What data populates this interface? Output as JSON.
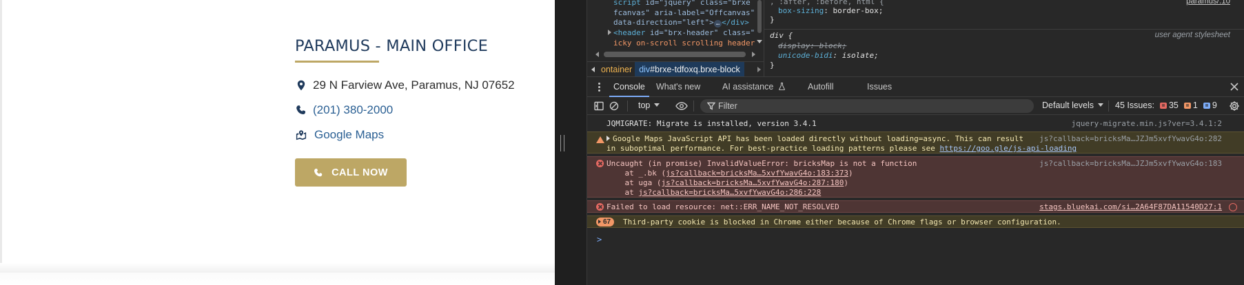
{
  "site": {
    "office_title": "PARAMUS - MAIN OFFICE",
    "address": "29 N Farview Ave, Paramus, NJ 07652",
    "phone": "(201) 380-2000",
    "maps_label": "Google Maps",
    "call_button": "CALL NOW",
    "colors": {
      "title": "#1f3a5c",
      "accent": "#bda765",
      "link": "#2a5f93"
    },
    "icons": {
      "address": "map-pin-icon",
      "phone": "phone-icon",
      "maps": "map-marked-icon",
      "call": "phone-icon"
    }
  },
  "devtools": {
    "elements": {
      "lines": [
        {
          "tag_open": "script",
          "attr": " id=\"jquery\" class=\"brxe",
          "text": ""
        },
        {
          "attr": "fcanvas\" aria-label=\"Offcanvas\""
        },
        {
          "attr": "data-direction=\"left\">",
          "ellipsis": "…",
          "close": "</div>"
        },
        {
          "tag_open": "<header",
          "attr": " id=\"brx-header\" class=\""
        },
        {
          "val": "icky on-scroll scrolling header"
        }
      ]
    },
    "breadcrumb": {
      "crumb1": "ontainer",
      "crumb2_tag": "div",
      "crumb2_rest": "#brxe-tdfoxq.brxe-block"
    },
    "styles": {
      "top_selector": ", :after, :before, html {",
      "top_source": "paramus/:10",
      "box_sizing_prop": "box-sizing",
      "box_sizing_val": "border-box;",
      "close1": "}",
      "div_selector": "div {",
      "ua_label": "user agent stylesheet",
      "display_prop": "display",
      "display_val": "block;",
      "unicode_prop": "unicode-bidi",
      "unicode_val": "isolate;",
      "close2": "}"
    },
    "drawer_tabs": [
      {
        "label": "Console",
        "active": true
      },
      {
        "label": "What's new",
        "active": false
      },
      {
        "label": "AI assistance",
        "active": false
      },
      {
        "label": "Autofill",
        "active": false
      },
      {
        "label": "Issues",
        "active": false
      }
    ],
    "toolbar": {
      "context": "top",
      "filter_placeholder": "Filter",
      "levels": "Default levels",
      "issues_label": "45 Issues:",
      "issues_errors": "35",
      "issues_warnings": "1",
      "issues_info": "9"
    },
    "console": {
      "log1": {
        "text": "JQMIGRATE: Migrate is installed, version 3.4.1",
        "source": "jquery-migrate.min.js?ver=3.4.1:2"
      },
      "warn1": {
        "line1": "Google Maps JavaScript API has been loaded directly without loading=async. This can result",
        "line2": "in suboptimal performance. For best-practice loading patterns please see ",
        "link": "https://goo.gle/js-api-loading",
        "source": "js?callback=bricksMa…JZJm5xvfYwavG4o:282"
      },
      "err1": {
        "line1": "Uncaught (in promise) InvalidValueError: bricksMap is not a function",
        "source": "js?callback=bricksMa…JZJm5xvfYwavG4o:183",
        "stack": [
          {
            "prefix": "    at _.bk (",
            "link": "js?callback=bricksMa…5xvfYwavG4o:183:373",
            "suffix": ")"
          },
          {
            "prefix": "    at uga (",
            "link": "js?callback=bricksMa…5xvfYwavG4o:287:180",
            "suffix": ")"
          },
          {
            "prefix": "    at ",
            "link": "js?callback=bricksMa…5xvfYwavG4o:286:228",
            "suffix": ""
          }
        ]
      },
      "err2": {
        "text": "Failed to load resource: net::ERR_NAME_NOT_RESOLVED",
        "source": "stags.bluekai.com/si…2A64F87DA11540D27:1"
      },
      "warn2": {
        "count": "67",
        "text": "Third-party cookie is blocked in Chrome either because of Chrome flags or browser configuration."
      },
      "prompt": ">"
    },
    "colors": {
      "bg": "#282828",
      "tab_accent": "#7cacf8",
      "error": "#e46962",
      "warning": "#f29766"
    }
  }
}
